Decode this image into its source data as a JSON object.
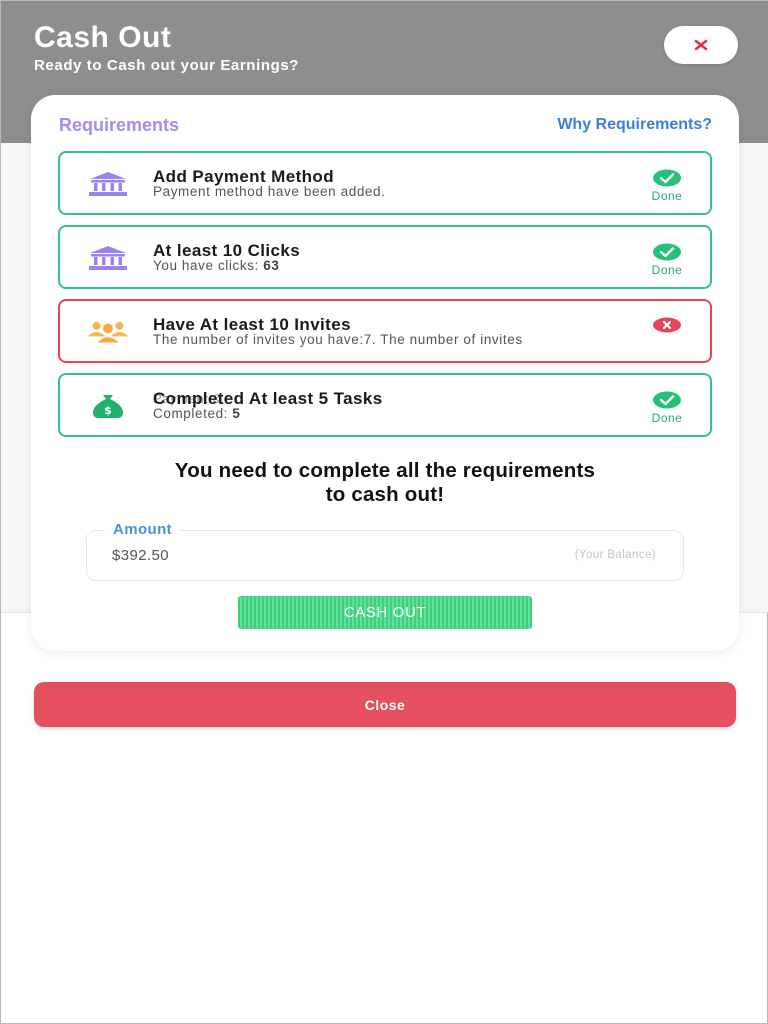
{
  "header": {
    "title": "Cash Out",
    "subtitle": "Ready to Cash out your Earnings?",
    "close_icon": "close-icon"
  },
  "requirements": {
    "heading": "Requirements",
    "why_link": "Why Requirements?",
    "items": [
      {
        "title": "Add Payment Method",
        "desc": "Payment method have been added.",
        "desc_value": "",
        "icon": "bank-icon",
        "status": "done",
        "status_label": "Done"
      },
      {
        "title": "At least 10 Clicks",
        "desc": "You have clicks: ",
        "desc_value": "63",
        "icon": "bank-icon",
        "status": "done",
        "status_label": "Done"
      },
      {
        "title": "Have At least 10 Invites",
        "desc": "The number of invites you have:7. The number of invites",
        "desc_value": "",
        "icon": "users-icon",
        "status": "failed",
        "status_label": ""
      },
      {
        "title": "Completed At least 5 Tasks",
        "desc": "Completed: ",
        "desc_value": "5",
        "icon": "money-bag-icon",
        "status": "done",
        "status_label": "Done",
        "ghost_text": "Payment &"
      }
    ]
  },
  "warning": "You need to complete all the requirements to cash out!",
  "amount": {
    "label": "Amount",
    "value": "$392.50",
    "hint": "(Your Balance)"
  },
  "cashout_button": "CASH OUT",
  "close_button": "Close",
  "colors": {
    "done": "#2fc581",
    "failed": "#e04856",
    "accent_purple": "#a78bf0",
    "link_blue": "#3b7fd9",
    "close_red": "#e4505f"
  }
}
